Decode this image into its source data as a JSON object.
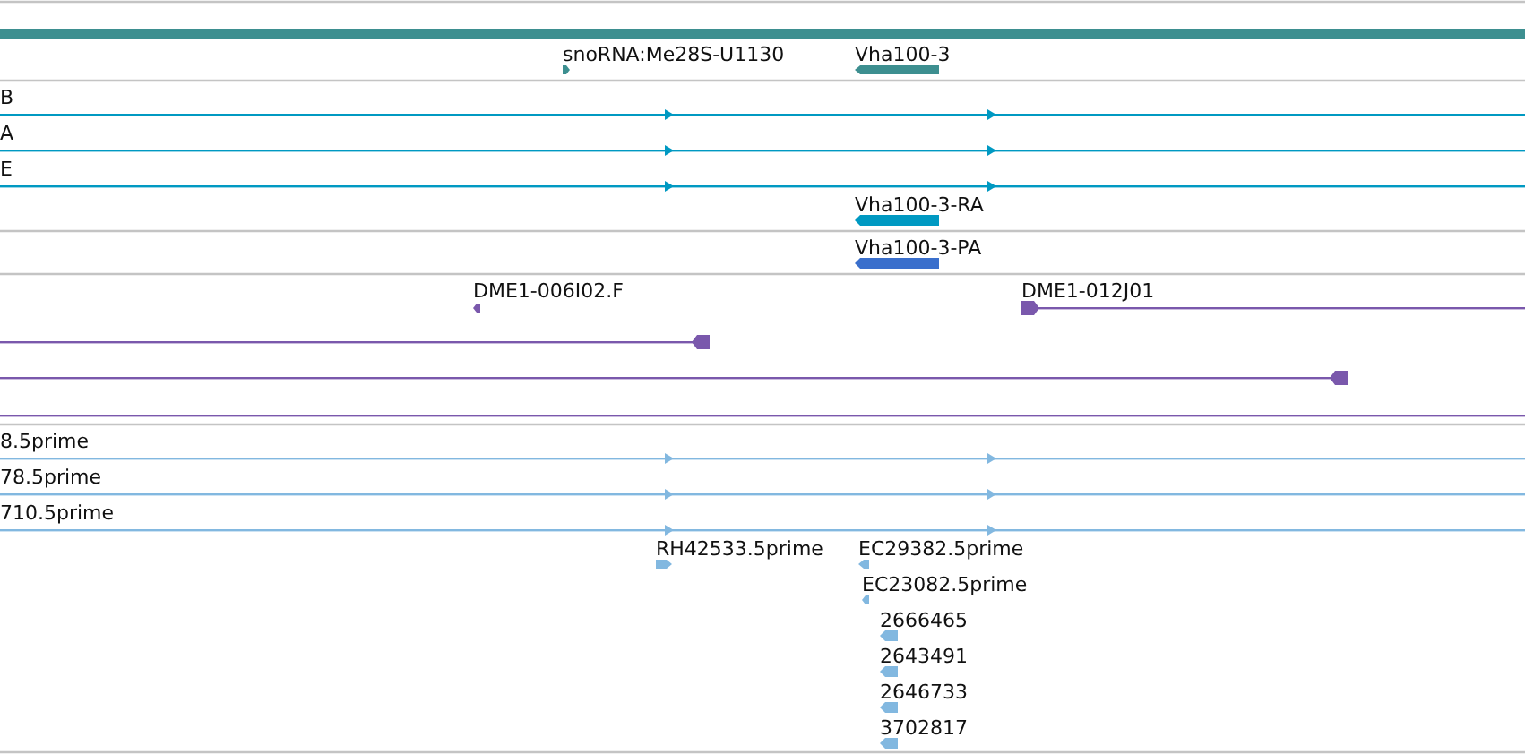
{
  "tracks": [
    {
      "color": "#3d8f90",
      "features": [
        {
          "kind": "block",
          "label": "snoRNA:Me28S-U1130",
          "reverse": false
        },
        {
          "kind": "block",
          "label": "Vha100-3",
          "reverse": true
        }
      ]
    },
    {
      "color": "#0099c2",
      "features": [
        {
          "kind": "line",
          "label": "B",
          "reverse": false
        },
        {
          "kind": "line",
          "label": "A",
          "reverse": false
        },
        {
          "kind": "line",
          "label": "E",
          "reverse": false
        },
        {
          "kind": "block",
          "label": "Vha100-3-RA",
          "reverse": true
        }
      ]
    },
    {
      "color": "#3a6fcc",
      "features": [
        {
          "kind": "block",
          "label": "Vha100-3-PA",
          "reverse": true
        }
      ]
    },
    {
      "color": "#7a58ac",
      "features": [
        {
          "kind": "block",
          "label": "DME1-006I02.F",
          "reverse": true
        },
        {
          "kind": "tail",
          "label": "DME1-012J01",
          "reverse": false
        },
        {
          "kind": "tail",
          "reverse": true
        },
        {
          "kind": "tail",
          "reverse": true
        },
        {
          "kind": "rule"
        }
      ]
    },
    {
      "color": "#82b8e0",
      "features": [
        {
          "kind": "line",
          "label": "8.5prime",
          "reverse": false
        },
        {
          "kind": "line",
          "label": "78.5prime",
          "reverse": false
        },
        {
          "kind": "line",
          "label": "710.5prime",
          "reverse": false
        },
        {
          "kind": "block",
          "label": "RH42533.5prime",
          "reverse": false
        },
        {
          "kind": "block",
          "label": "EC29382.5prime",
          "reverse": true
        },
        {
          "kind": "block",
          "label": "EC23082.5prime",
          "reverse": true
        },
        {
          "kind": "block",
          "label": "2666465",
          "reverse": true
        },
        {
          "kind": "block",
          "label": "2643491",
          "reverse": true
        },
        {
          "kind": "block",
          "label": "2646733",
          "reverse": true
        },
        {
          "kind": "block",
          "label": "3702817",
          "reverse": true
        }
      ]
    }
  ]
}
